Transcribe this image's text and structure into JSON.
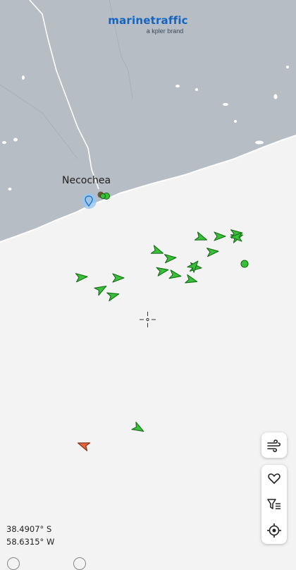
{
  "brand": {
    "name": "marinetraffic",
    "tagline": "a kpler brand"
  },
  "map": {
    "land_color": "#b6bdc5",
    "sea_color": "#f3f3f3",
    "city_label": "Necochea",
    "vessels": [
      {
        "kind": "arrow",
        "color": "#38c038",
        "heading": 200
      },
      {
        "kind": "arrow",
        "color": "#38c038",
        "heading": 180
      },
      {
        "kind": "arrow",
        "color": "#38c038",
        "heading": 160
      },
      {
        "kind": "arrow",
        "color": "#38c038",
        "heading": 200
      },
      {
        "kind": "arrow",
        "color": "#38c038",
        "heading": 175
      },
      {
        "kind": "arrow",
        "color": "#38c038",
        "heading": 175
      },
      {
        "kind": "arrow",
        "color": "#38c038",
        "heading": 170
      },
      {
        "kind": "arrow",
        "color": "#38c038",
        "heading": 190
      },
      {
        "kind": "arrow",
        "color": "#38c038",
        "heading": 185
      },
      {
        "kind": "arrow",
        "color": "#38c038",
        "heading": 195
      },
      {
        "kind": "arrow",
        "color": "#38c038",
        "heading": 175
      },
      {
        "kind": "arrow",
        "color": "#38c038",
        "heading": 150
      },
      {
        "kind": "arrow",
        "color": "#38c038",
        "heading": 165
      },
      {
        "kind": "arrow",
        "color": "#38c038",
        "heading": 180
      },
      {
        "kind": "arrow",
        "color": "#38c038",
        "heading": 210
      },
      {
        "kind": "arrow",
        "color": "#38c038",
        "heading": 130
      },
      {
        "kind": "arrow",
        "color": "#38c038",
        "heading": 175
      },
      {
        "kind": "circle",
        "color": "#38c038"
      },
      {
        "kind": "arrow",
        "color": "#38c038",
        "heading": 0
      },
      {
        "kind": "arrow",
        "color": "#e8663a",
        "heading": 20
      }
    ]
  },
  "controls": {
    "weather": "wind-icon",
    "favorites": "heart-icon",
    "filter": "filter-icon",
    "locate": "crosshair-icon"
  },
  "coords": {
    "lat": "38.4907° S",
    "lon": "58.6315° W"
  }
}
